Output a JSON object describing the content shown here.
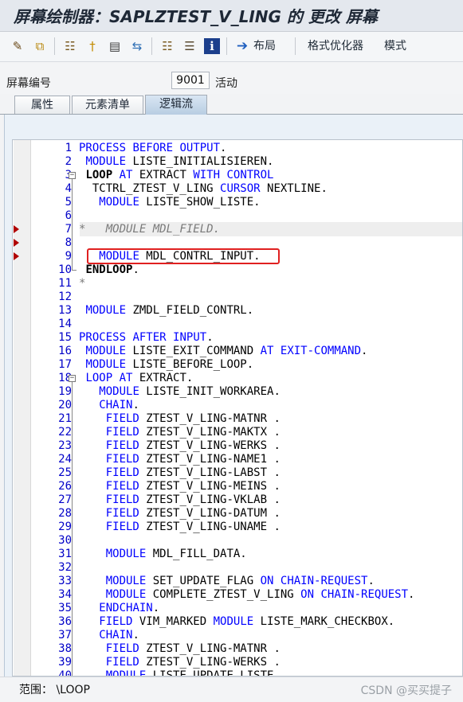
{
  "title": "屏幕绘制器：SAPLZTEST_V_LING 的 更改 屏幕",
  "toolbar": {
    "icons": [
      "pencil-icon",
      "copy-check-icon",
      "hierarchy-icon",
      "pin-icon",
      "layout-icon",
      "navigate-icon",
      "tree-icon",
      "list-icon",
      "info-icon"
    ],
    "layout_label": "布局",
    "formatter_label": "格式优化器",
    "mode_label": "模式"
  },
  "screen": {
    "label": "屏幕编号",
    "number": "9001",
    "status": "活动"
  },
  "tabs": [
    {
      "label": "属性",
      "active": false
    },
    {
      "label": "元素清单",
      "active": false
    },
    {
      "label": "逻辑流",
      "active": true
    }
  ],
  "code_lines": [
    {
      "num": "1",
      "tokens": [
        [
          "kw",
          "PROCESS"
        ],
        [
          "t",
          " "
        ],
        [
          "kw",
          "BEFORE"
        ],
        [
          "t",
          " "
        ],
        [
          "kw",
          "OUTPUT"
        ],
        [
          "t",
          "."
        ]
      ]
    },
    {
      "num": "2",
      "tokens": [
        [
          "t",
          " "
        ],
        [
          "kw",
          "MODULE"
        ],
        [
          "t",
          " LISTE_INITIALISIEREN."
        ]
      ]
    },
    {
      "num": "3",
      "tokens": [
        [
          "t",
          " "
        ],
        [
          "b",
          "LOOP"
        ],
        [
          "t",
          " "
        ],
        [
          "kw",
          "AT"
        ],
        [
          "t",
          " EXTRACT "
        ],
        [
          "kw",
          "WITH"
        ],
        [
          "t",
          " "
        ],
        [
          "kw",
          "CONTROL"
        ]
      ]
    },
    {
      "num": "4",
      "tokens": [
        [
          "t",
          "  TCTRL_ZTEST_V_LING "
        ],
        [
          "kw",
          "CURSOR"
        ],
        [
          "t",
          " NEXTLINE."
        ]
      ]
    },
    {
      "num": "5",
      "tokens": [
        [
          "t",
          "   "
        ],
        [
          "kw",
          "MODULE"
        ],
        [
          "t",
          " LISTE_SHOW_LISTE."
        ]
      ]
    },
    {
      "num": "6",
      "tokens": []
    },
    {
      "num": "7",
      "tokens": [
        [
          "cm",
          "*   MODULE MDL_FIELD."
        ]
      ]
    },
    {
      "num": "8",
      "tokens": []
    },
    {
      "num": "9",
      "tokens": [
        [
          "t",
          "   "
        ],
        [
          "kw",
          "MODULE"
        ],
        [
          "t",
          " MDL_CONTRL_INPUT."
        ]
      ]
    },
    {
      "num": "10",
      "tokens": [
        [
          "t",
          " "
        ],
        [
          "b",
          "ENDLOOP"
        ],
        [
          "t",
          "."
        ]
      ]
    },
    {
      "num": "11",
      "tokens": [
        [
          "cm",
          "*"
        ]
      ]
    },
    {
      "num": "12",
      "tokens": []
    },
    {
      "num": "13",
      "tokens": [
        [
          "t",
          " "
        ],
        [
          "kw",
          "MODULE"
        ],
        [
          "t",
          " ZMDL_FIELD_CONTRL."
        ]
      ]
    },
    {
      "num": "14",
      "tokens": []
    },
    {
      "num": "15",
      "tokens": [
        [
          "kw",
          "PROCESS"
        ],
        [
          "t",
          " "
        ],
        [
          "kw",
          "AFTER"
        ],
        [
          "t",
          " "
        ],
        [
          "kw",
          "INPUT"
        ],
        [
          "t",
          "."
        ]
      ]
    },
    {
      "num": "16",
      "tokens": [
        [
          "t",
          " "
        ],
        [
          "kw",
          "MODULE"
        ],
        [
          "t",
          " LISTE_EXIT_COMMAND "
        ],
        [
          "kw",
          "AT"
        ],
        [
          "t",
          " "
        ],
        [
          "kw",
          "EXIT-COMMAND"
        ],
        [
          "t",
          "."
        ]
      ]
    },
    {
      "num": "17",
      "tokens": [
        [
          "t",
          " "
        ],
        [
          "kw",
          "MODULE"
        ],
        [
          "t",
          " LISTE_BEFORE_LOOP."
        ]
      ]
    },
    {
      "num": "18",
      "tokens": [
        [
          "t",
          " "
        ],
        [
          "kw",
          "LOOP"
        ],
        [
          "t",
          " "
        ],
        [
          "kw",
          "AT"
        ],
        [
          "t",
          " EXTRACT."
        ]
      ]
    },
    {
      "num": "19",
      "tokens": [
        [
          "t",
          "   "
        ],
        [
          "kw",
          "MODULE"
        ],
        [
          "t",
          " LISTE_INIT_WORKAREA."
        ]
      ]
    },
    {
      "num": "20",
      "tokens": [
        [
          "t",
          "   "
        ],
        [
          "kw",
          "CHAIN"
        ],
        [
          "t",
          "."
        ]
      ]
    },
    {
      "num": "21",
      "tokens": [
        [
          "t",
          "    "
        ],
        [
          "kw",
          "FIELD"
        ],
        [
          "t",
          " ZTEST_V_LING-MATNR ."
        ]
      ]
    },
    {
      "num": "22",
      "tokens": [
        [
          "t",
          "    "
        ],
        [
          "kw",
          "FIELD"
        ],
        [
          "t",
          " ZTEST_V_LING-MAKTX ."
        ]
      ]
    },
    {
      "num": "23",
      "tokens": [
        [
          "t",
          "    "
        ],
        [
          "kw",
          "FIELD"
        ],
        [
          "t",
          " ZTEST_V_LING-WERKS ."
        ]
      ]
    },
    {
      "num": "24",
      "tokens": [
        [
          "t",
          "    "
        ],
        [
          "kw",
          "FIELD"
        ],
        [
          "t",
          " ZTEST_V_LING-NAME1 ."
        ]
      ]
    },
    {
      "num": "25",
      "tokens": [
        [
          "t",
          "    "
        ],
        [
          "kw",
          "FIELD"
        ],
        [
          "t",
          " ZTEST_V_LING-LABST ."
        ]
      ]
    },
    {
      "num": "26",
      "tokens": [
        [
          "t",
          "    "
        ],
        [
          "kw",
          "FIELD"
        ],
        [
          "t",
          " ZTEST_V_LING-MEINS ."
        ]
      ]
    },
    {
      "num": "27",
      "tokens": [
        [
          "t",
          "    "
        ],
        [
          "kw",
          "FIELD"
        ],
        [
          "t",
          " ZTEST_V_LING-VKLAB ."
        ]
      ]
    },
    {
      "num": "28",
      "tokens": [
        [
          "t",
          "    "
        ],
        [
          "kw",
          "FIELD"
        ],
        [
          "t",
          " ZTEST_V_LING-DATUM ."
        ]
      ]
    },
    {
      "num": "29",
      "tokens": [
        [
          "t",
          "    "
        ],
        [
          "kw",
          "FIELD"
        ],
        [
          "t",
          " ZTEST_V_LING-UNAME ."
        ]
      ]
    },
    {
      "num": "30",
      "tokens": []
    },
    {
      "num": "31",
      "tokens": [
        [
          "t",
          "    "
        ],
        [
          "kw",
          "MODULE"
        ],
        [
          "t",
          " MDL_FILL_DATA."
        ]
      ]
    },
    {
      "num": "32",
      "tokens": []
    },
    {
      "num": "33",
      "tokens": [
        [
          "t",
          "    "
        ],
        [
          "kw",
          "MODULE"
        ],
        [
          "t",
          " SET_UPDATE_FLAG "
        ],
        [
          "kw",
          "ON"
        ],
        [
          "t",
          " "
        ],
        [
          "kw",
          "CHAIN-REQUEST"
        ],
        [
          "t",
          "."
        ]
      ]
    },
    {
      "num": "34",
      "tokens": [
        [
          "t",
          "    "
        ],
        [
          "kw",
          "MODULE"
        ],
        [
          "t",
          " COMPLETE_ZTEST_V_LING "
        ],
        [
          "kw",
          "ON"
        ],
        [
          "t",
          " "
        ],
        [
          "kw",
          "CHAIN-REQUEST"
        ],
        [
          "t",
          "."
        ]
      ]
    },
    {
      "num": "35",
      "tokens": [
        [
          "t",
          "   "
        ],
        [
          "kw",
          "ENDCHAIN"
        ],
        [
          "t",
          "."
        ]
      ]
    },
    {
      "num": "36",
      "tokens": [
        [
          "t",
          "   "
        ],
        [
          "kw",
          "FIELD"
        ],
        [
          "t",
          " VIM_MARKED "
        ],
        [
          "kw",
          "MODULE"
        ],
        [
          "t",
          " LISTE_MARK_CHECKBOX."
        ]
      ]
    },
    {
      "num": "37",
      "tokens": [
        [
          "t",
          "   "
        ],
        [
          "kw",
          "CHAIN"
        ],
        [
          "t",
          "."
        ]
      ]
    },
    {
      "num": "38",
      "tokens": [
        [
          "t",
          "    "
        ],
        [
          "kw",
          "FIELD"
        ],
        [
          "t",
          " ZTEST_V_LING-MATNR ."
        ]
      ]
    },
    {
      "num": "39",
      "tokens": [
        [
          "t",
          "    "
        ],
        [
          "kw",
          "FIELD"
        ],
        [
          "t",
          " ZTEST_V_LING-WERKS ."
        ]
      ]
    },
    {
      "num": "40",
      "tokens": [
        [
          "t",
          "    "
        ],
        [
          "kw",
          "MODULE"
        ],
        [
          "t",
          " LISTE_UPDATE_LISTE."
        ]
      ]
    }
  ],
  "statusbar": {
    "scope": "范围：  \\LOOP",
    "watermark": "CSDN @买买提子"
  }
}
